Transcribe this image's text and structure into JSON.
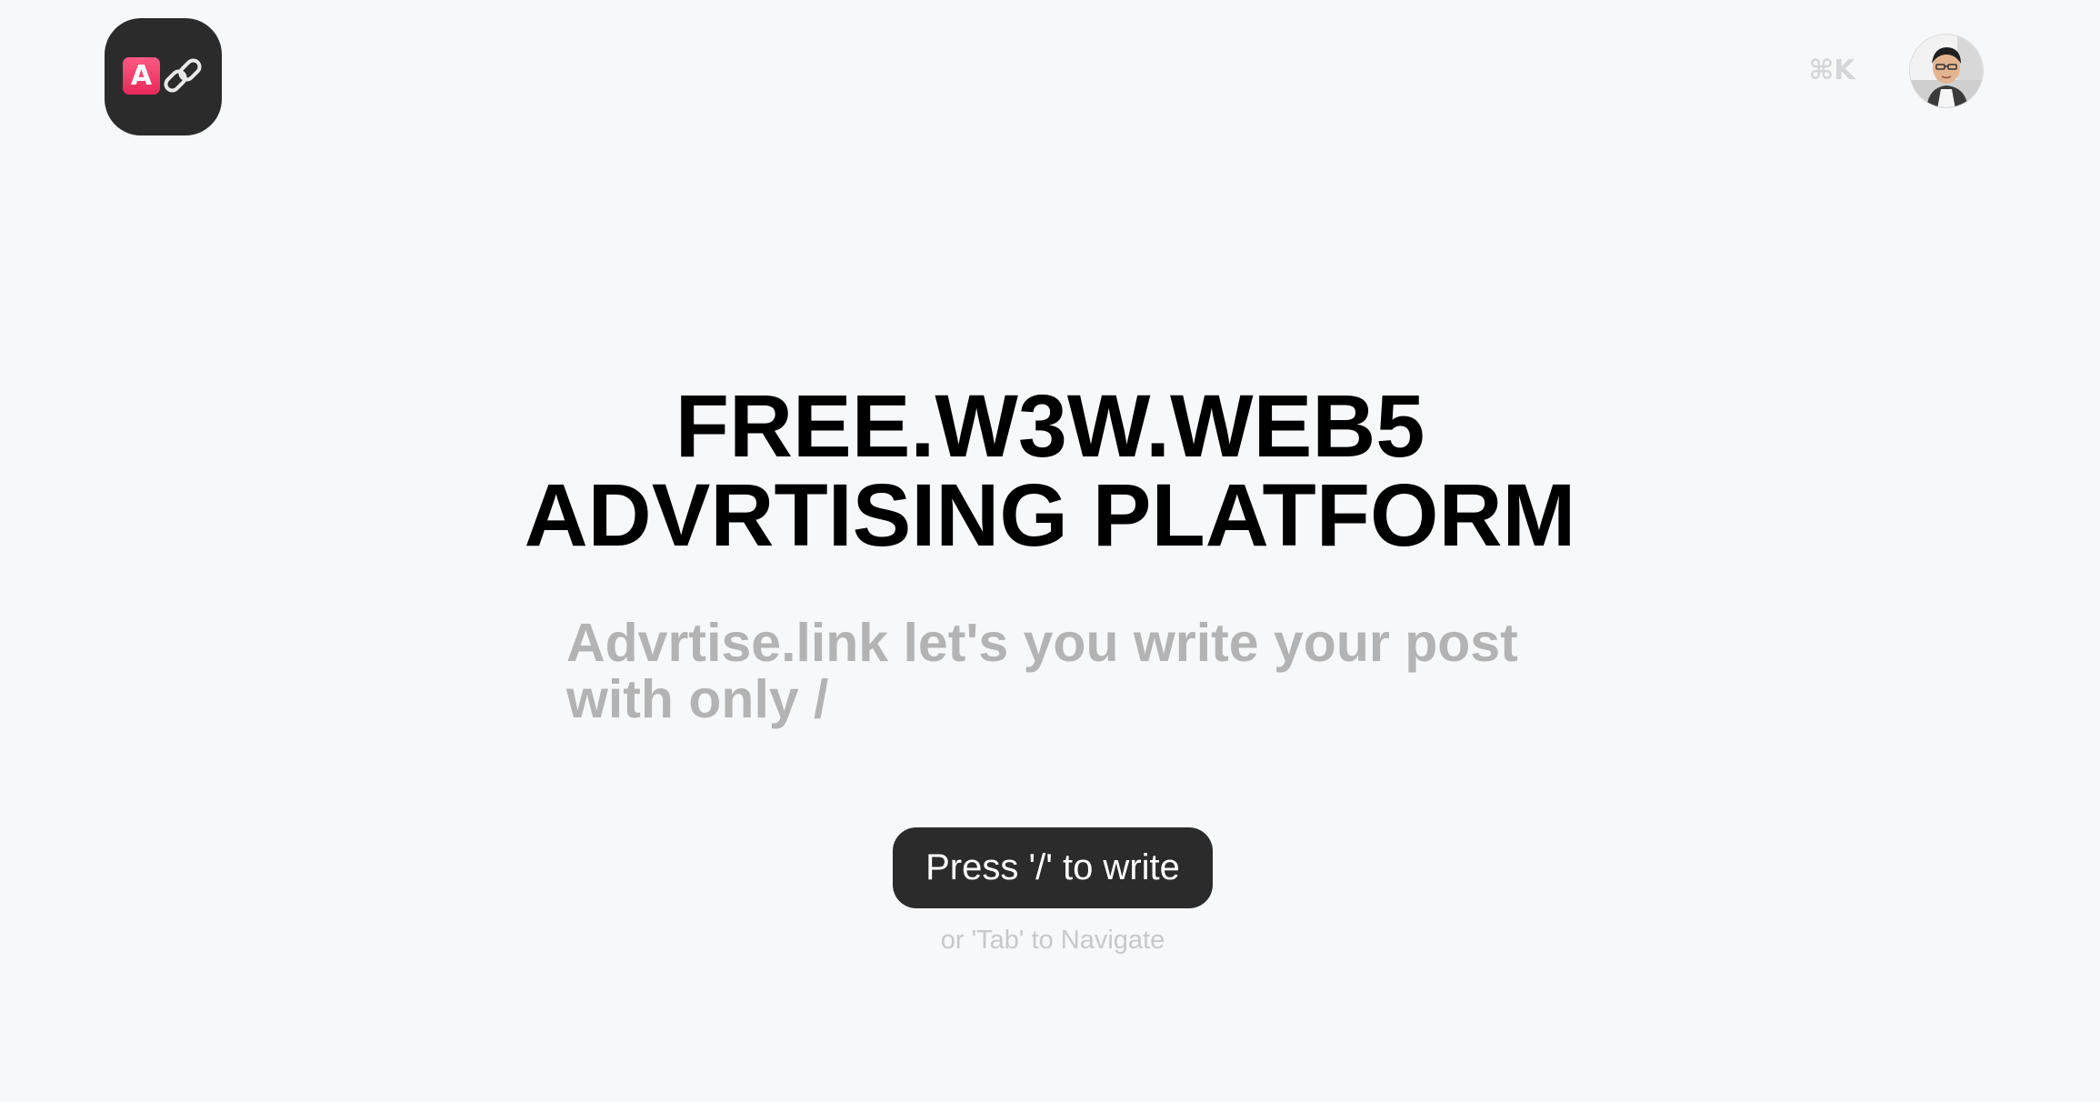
{
  "header": {
    "logo_letter": "A",
    "shortcut_hint": "⌘K"
  },
  "hero": {
    "title_line1": "FREE.W3W.WEB5",
    "title_line2": "ADVRTISING PLATFORM",
    "subtitle": "Advrtise.link let's you write your post with only /"
  },
  "cta": {
    "button_label": "Press '/' to write",
    "secondary_hint": "or 'Tab' to Navigate"
  },
  "colors": {
    "background": "#f7f8fa",
    "accent": "#e8285a",
    "button_bg": "#2b2b2c"
  },
  "icons": {
    "logo_badge": "letter-a-badge",
    "logo_link": "chain-link-icon",
    "avatar": "user-avatar"
  }
}
